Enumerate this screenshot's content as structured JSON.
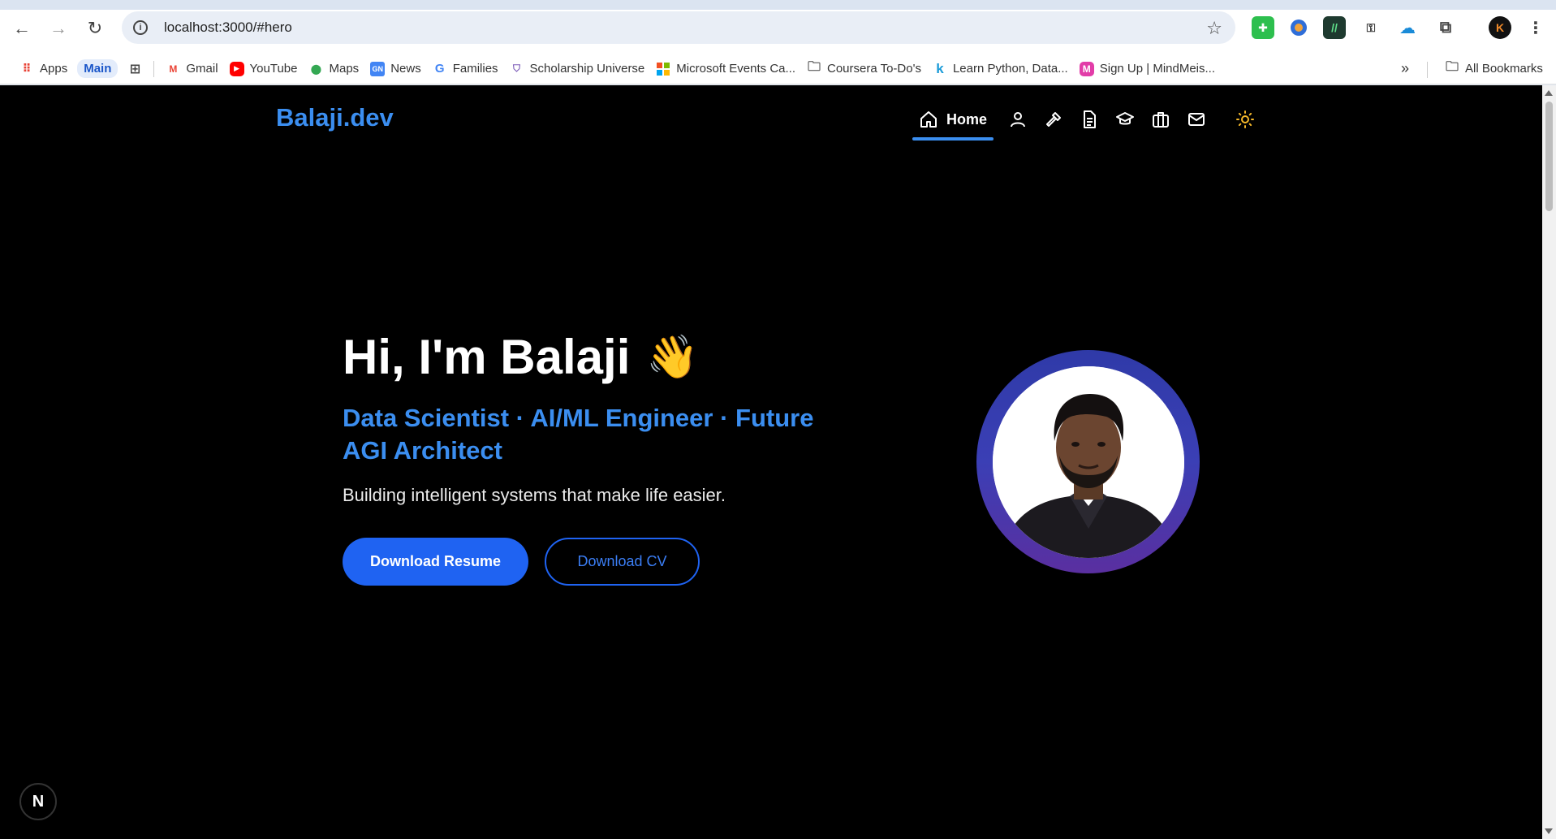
{
  "browser": {
    "url": "localhost:3000/#hero",
    "bookmarks": [
      {
        "label": "Apps",
        "icon": "apps-grid-icon"
      },
      {
        "label": "Main",
        "icon": "folder-icon"
      },
      {
        "label": "",
        "icon": "tab-groups-icon"
      },
      {
        "label": "Gmail",
        "icon": "gmail-icon"
      },
      {
        "label": "YouTube",
        "icon": "youtube-icon"
      },
      {
        "label": "Maps",
        "icon": "maps-icon"
      },
      {
        "label": "News",
        "icon": "news-icon"
      },
      {
        "label": "Families",
        "icon": "google-icon"
      },
      {
        "label": "Scholarship Universe",
        "icon": "scholarship-icon"
      },
      {
        "label": "Microsoft Events Ca...",
        "icon": "microsoft-icon"
      },
      {
        "label": "Coursera To-Do's",
        "icon": "folder-icon"
      },
      {
        "label": "Learn Python, Data...",
        "icon": "k-icon"
      },
      {
        "label": "Sign Up | MindMeis...",
        "icon": "mindmeister-icon"
      }
    ],
    "all_bookmarks": "All Bookmarks",
    "overflow": "»",
    "profile_initial": "K"
  },
  "site": {
    "logo": "Balaji.dev",
    "nav": {
      "home_label": "Home"
    },
    "hero": {
      "title": "Hi, I'm Balaji",
      "wave": "👋",
      "subtitle": "Data Scientist · AI/ML Engineer · Future AGI Architect",
      "description": "Building intelligent systems that make life easier.",
      "primary_button": "Download Resume",
      "secondary_button": "Download CV"
    },
    "colors": {
      "accent": "#3b8ef0",
      "button": "#1f63f2",
      "background": "#000000",
      "ring": "#3b3fb5"
    },
    "dev_badge": "N"
  }
}
